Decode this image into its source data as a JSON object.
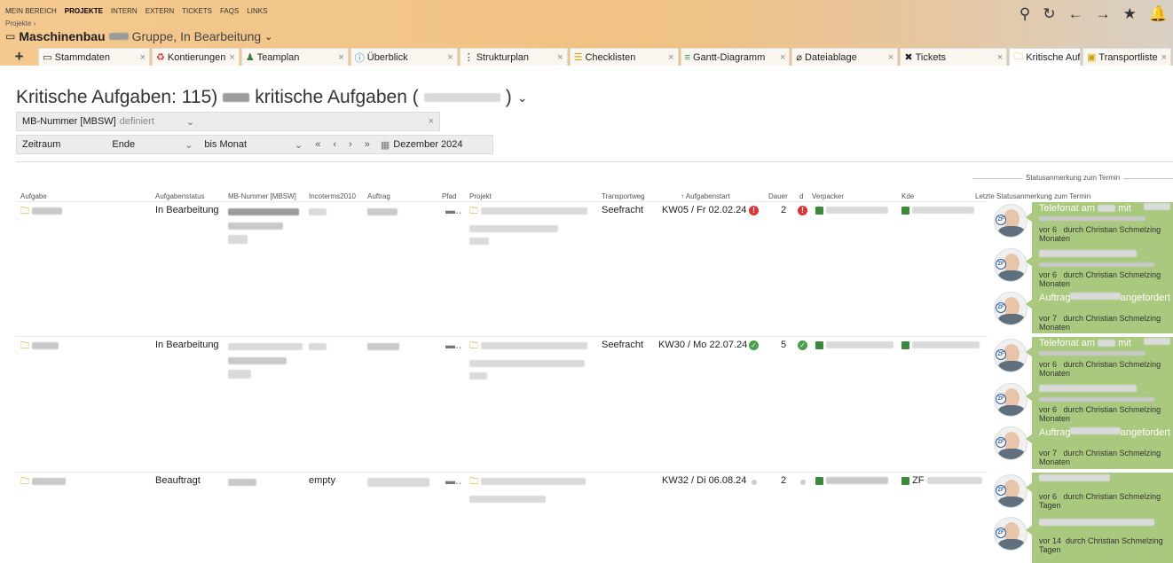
{
  "topnav": {
    "items": [
      "MEIN BEREICH",
      "PROJEKTE",
      "INTERN",
      "EXTERN",
      "TICKETS",
      "FAQS",
      "LINKS"
    ]
  },
  "breadcrumb": "Projekte ›",
  "project": {
    "name": "Maschinenbau",
    "suffix": "Gruppe, In Bearbeitung"
  },
  "tabs": [
    {
      "label": "Stammdaten",
      "icon": "card-icon"
    },
    {
      "label": "Kontierungen",
      "icon": "accounting-icon"
    },
    {
      "label": "Teamplan",
      "icon": "team-icon"
    },
    {
      "label": "Überblick",
      "icon": "info-icon"
    },
    {
      "label": "Strukturplan",
      "icon": "tree-icon"
    },
    {
      "label": "Checklisten",
      "icon": "checklist-icon"
    },
    {
      "label": "Gantt-Diagramm",
      "icon": "gantt-icon"
    },
    {
      "label": "Dateiablage",
      "icon": "paperclip-icon"
    },
    {
      "label": "Tickets",
      "icon": "tools-icon"
    },
    {
      "label": "Kritische Aufgabe",
      "icon": "folder-icon"
    },
    {
      "label": "Transportliste",
      "icon": "transport-icon"
    }
  ],
  "page": {
    "title_pre": "Kritische Aufgaben: 115)",
    "title_mid": "kritische Aufgaben (",
    "title_post": ")"
  },
  "filters": {
    "mb_label": "MB-Nummer [MBSW]",
    "mb_value": "definiert",
    "zeitraum_label": "Zeitraum",
    "ende": "Ende",
    "bis_monat": "bis Monat",
    "month": "Dezember 2024"
  },
  "table": {
    "status_group": "Statusanmerkung zum Termin",
    "headers": [
      "Aufgabe",
      "Aufgabenstatus",
      "MB-Nummer [MBSW]",
      "Incoterms2010",
      "Auftrag",
      "Pfad",
      "Projekt",
      "Transportweg",
      "↑ Aufgabenstart",
      "Dauer",
      "d",
      "Verpacker",
      "Kde",
      "Letzte Statusanmerkung zum Termin"
    ],
    "rows": [
      {
        "status": "In Bearbeitung",
        "incoterms": "",
        "transport": "Seefracht",
        "start": "KW05 / Fr 02.02.24",
        "dauer": "2",
        "kde": ""
      },
      {
        "status": "In Bearbeitung",
        "incoterms": "",
        "transport": "Seefracht",
        "start": "KW30 / Mo 22.07.24",
        "dauer": "5",
        "kde": ""
      },
      {
        "status": "Beauftragt",
        "incoterms": "empty",
        "transport": "",
        "start": "KW32 / Di 06.08.24",
        "dauer": "2",
        "kde": "ZF"
      }
    ],
    "notes": {
      "t1": "Telefonat am",
      "t1b": "mit",
      "t2": "Auftrag",
      "t2b": "angefordert",
      "by6m": "vor 6 durch Christian Schmelzing Monaten",
      "by7m": "vor 7 durch Christian Schmelzing Monaten",
      "by6t": "vor 6 durch Christian Schmelzing Tagen",
      "by14t": "vor 14 durch Christian Schmelzing Tagen",
      "vor6": "vor 6",
      "vor7": "vor 7",
      "vor14": "vor 14",
      "durch": "durch Christian Schmelzing",
      "monaten": "Monaten",
      "tagen": "Tagen"
    }
  }
}
